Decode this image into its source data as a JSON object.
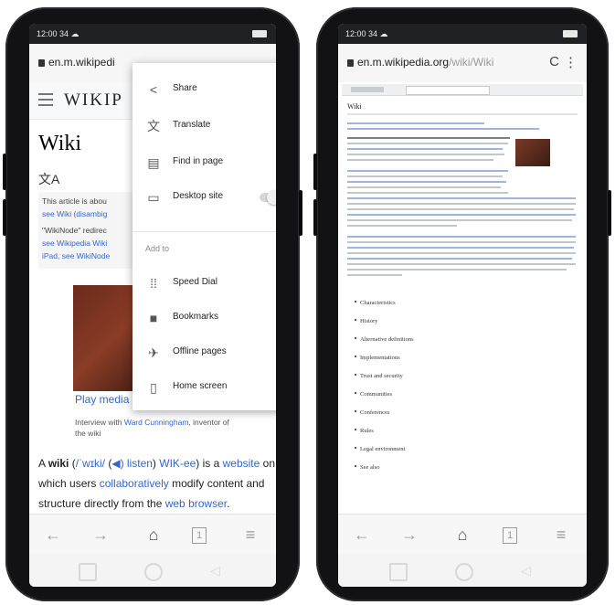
{
  "left": {
    "status_time": "12:00 34 ☁",
    "url_host": "en.m.wikipedi",
    "wiki_logo": "WIKIP",
    "page_title": "Wiki",
    "translate_glyph": "文A",
    "hatnote_lines": [
      "This article is abou",
      "see Wiki (disambig",
      "\"WikiNode\" redirec",
      "see Wikipedia Wiki",
      "iPad, see WikiNode"
    ],
    "play_media": "Play media",
    "caption_prefix": "Interview with ",
    "caption_link": "Ward Cunningham",
    "caption_suffix": ", inventor of the wiki",
    "body": {
      "p1": "A ",
      "wiki": "wiki",
      "p2": " (",
      "ipa": "/ˈwɪki/",
      "p3": " (",
      "listen": "◀) listen",
      "p4": ") ",
      "wikwik": "WIK-ee",
      "p5": ") is a ",
      "website": "website",
      "p6": " on which users ",
      "collab": "collaboratively",
      "p7": " modify content and structure directly from the ",
      "browser": "web browser",
      "p8": "."
    },
    "menu": {
      "items": [
        {
          "icon": "share-icon",
          "label": "Share"
        },
        {
          "icon": "translate-icon",
          "label": "Translate"
        },
        {
          "icon": "find-icon",
          "label": "Find in page"
        },
        {
          "icon": "desktop-icon",
          "label": "Desktop site"
        }
      ],
      "section_label": "Add to",
      "add_items": [
        {
          "icon": "speed-dial-icon",
          "label": "Speed Dial"
        },
        {
          "icon": "bookmark-icon",
          "label": "Bookmarks"
        },
        {
          "icon": "offline-icon",
          "label": "Offline pages"
        },
        {
          "icon": "home-screen-icon",
          "label": "Home screen"
        }
      ]
    },
    "nav": {
      "back": "←",
      "forward": "→",
      "home": "⌂",
      "tabs": "1",
      "menu": "≡"
    }
  },
  "right": {
    "status_time": "12:00 34 ☁",
    "url_host": "en.m.wikipedia.org",
    "url_path": "/wiki/Wiki",
    "reload": "C",
    "more": "⋮",
    "desk_title": "Wiki",
    "toc": [
      "Characteristics",
      "History",
      "Alternative definitions",
      "Implementations",
      "Trust and security",
      "Communities",
      "Conferences",
      "Rules",
      "Legal environment",
      "See also"
    ],
    "nav": {
      "back": "←",
      "forward": "→",
      "home": "⌂",
      "tabs": "1",
      "menu": "≡"
    }
  }
}
